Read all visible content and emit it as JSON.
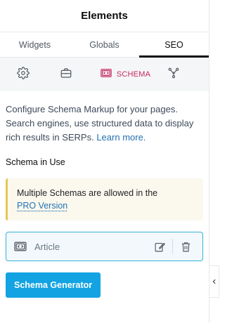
{
  "header": {
    "title": "Elements"
  },
  "tabs": [
    {
      "label": "Widgets"
    },
    {
      "label": "Globals"
    },
    {
      "label": "SEO"
    }
  ],
  "subtabs": {
    "schema_label": "SCHEMA",
    "icons": [
      "gear-icon",
      "briefcase-icon",
      "schema-icon",
      "nodes-icon"
    ]
  },
  "content": {
    "description": "Configure Schema Markup for your pages. Search engines, use structured data to display rich results in SERPs.",
    "learn_more": "Learn more.",
    "section_label": "Schema in Use",
    "notice_text": "Multiple Schemas are allowed in the",
    "notice_link": "PRO Version",
    "schema_item": "Article",
    "generator_button": "Schema Generator"
  },
  "colors": {
    "accent": "#c6285f",
    "button": "#13a3e3",
    "link": "#2271b1",
    "notice_border": "#e6c65a"
  }
}
